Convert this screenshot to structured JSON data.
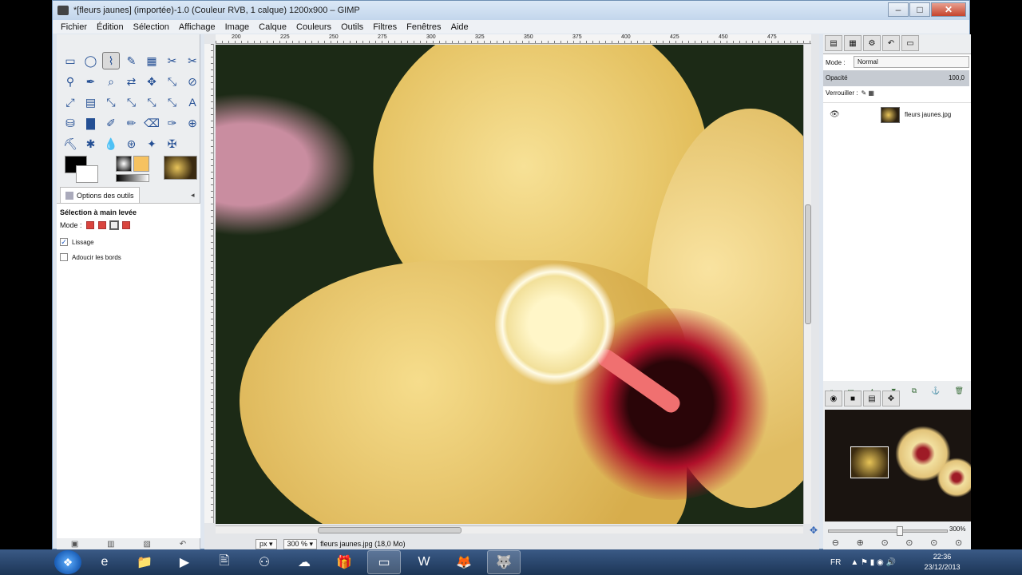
{
  "window": {
    "title": "*[fleurs jaunes] (importée)-1.0 (Couleur RVB, 1 calque) 1200x900 – GIMP",
    "min": "–",
    "max": "□",
    "close": "✕"
  },
  "menu": [
    "Fichier",
    "Édition",
    "Sélection",
    "Affichage",
    "Image",
    "Calque",
    "Couleurs",
    "Outils",
    "Filtres",
    "Fenêtres",
    "Aide"
  ],
  "tools": [
    "▭",
    "◯",
    "⌇",
    "✎",
    "▦",
    "✂",
    "✂",
    "⚲",
    "✒",
    "⌕",
    "⇄",
    "✥",
    "⤡",
    "⊘",
    "⤢",
    "▤",
    "⤡",
    "⤡",
    "⤡",
    "⤡",
    "A",
    "⛁",
    "▇",
    "✐",
    "✏",
    "⌫",
    "✑",
    "⊕",
    "⛏",
    "✱",
    "💧",
    "⊛",
    "✦",
    "✠"
  ],
  "tool_icon_names": [
    "rect-select-icon",
    "ellipse-select-icon",
    "free-select-icon",
    "fuzzy-select-icon",
    "color-select-icon",
    "scissors-icon",
    "foreground-select-icon",
    "paths-icon",
    "color-picker-icon",
    "zoom-icon",
    "measure-icon",
    "move-icon",
    "align-icon",
    "crop-icon",
    "rotate-icon",
    "scale-icon",
    "shear-icon",
    "perspective-icon",
    "flip-icon",
    "cage-icon",
    "text-icon",
    "bucket-fill-icon",
    "gradient-icon",
    "pencil-icon",
    "paintbrush-icon",
    "eraser-icon",
    "airbrush-icon",
    "ink-icon",
    "clone-icon",
    "heal-icon",
    "blur-icon",
    "smudge-icon",
    "dodge-icon",
    "burn-icon"
  ],
  "options": {
    "tab_label": "Options des outils",
    "close": "◂",
    "title": "Sélection à main levée",
    "mode_label": "Mode :",
    "lissage_label": "Lissage",
    "lissage_checked": "✓",
    "adoucir_label": "Adoucir les bords",
    "bottom_icons": [
      "▣",
      "▥",
      "▧",
      "↶"
    ]
  },
  "rulers": {
    "h_labels": [
      "200",
      "225",
      "250",
      "275",
      "300",
      "325",
      "350",
      "375",
      "400",
      "425",
      "450",
      "475"
    ]
  },
  "status": {
    "unit": "px ▾",
    "zoom": "300 % ▾",
    "file_info": "fleurs jaunes.jpg (18,0 Mo)"
  },
  "layers": {
    "tab_icons": [
      "▤",
      "▦",
      "⚙",
      "↶",
      "▭"
    ],
    "mode_label": "Mode :",
    "mode_value": "Normal",
    "opacity_label": "Opacité",
    "opacity_value": "100,0",
    "lock_label": "Verrouiller :",
    "lock_icons": "✎ ▦",
    "layer_name": "fleurs jaunes.jpg",
    "eye": "👁",
    "buttons": [
      "▫",
      "▭",
      "▲",
      "▼",
      "⧉",
      "⚓",
      "🗑"
    ]
  },
  "navigator": {
    "tab_icons": [
      "◉",
      "■",
      "▤",
      "✥"
    ],
    "zoom_pct": "300%",
    "buttons": [
      "⊖",
      "⊕",
      "⊙",
      "⊙",
      "⊙",
      "⊙"
    ]
  },
  "taskbar": {
    "start": "❖",
    "apps": [
      "e",
      "📁",
      "▶",
      "🖹",
      "⚇",
      "☁",
      "🎁",
      "▭",
      "W",
      "🦊",
      "🐺"
    ],
    "tray_lang": "FR",
    "tray_syms": "▲ ⚑ ▮ ◉ 🔊",
    "time": "22:36",
    "date": "23/12/2013"
  }
}
